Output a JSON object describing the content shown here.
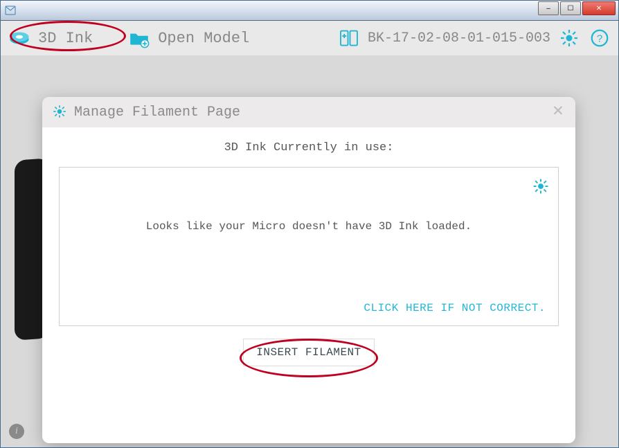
{
  "window": {
    "minimize_glyph": "–",
    "maximize_glyph": "☐",
    "close_glyph": "✕"
  },
  "toolbar": {
    "ink_label": "3D Ink",
    "open_model_label": "Open Model",
    "printer_id": "BK-17-02-08-01-015-003"
  },
  "modal": {
    "title": "Manage Filament Page",
    "subtitle": "3D Ink Currently in use:",
    "empty_message": "Looks like your Micro doesn't have 3D Ink loaded.",
    "not_correct_link": "CLICK HERE IF NOT CORRECT.",
    "insert_button": "INSERT FILAMENT",
    "close_glyph": "✕"
  },
  "info_badge": "i",
  "colors": {
    "accent": "#1fb6d4",
    "annotation": "#c00020"
  }
}
